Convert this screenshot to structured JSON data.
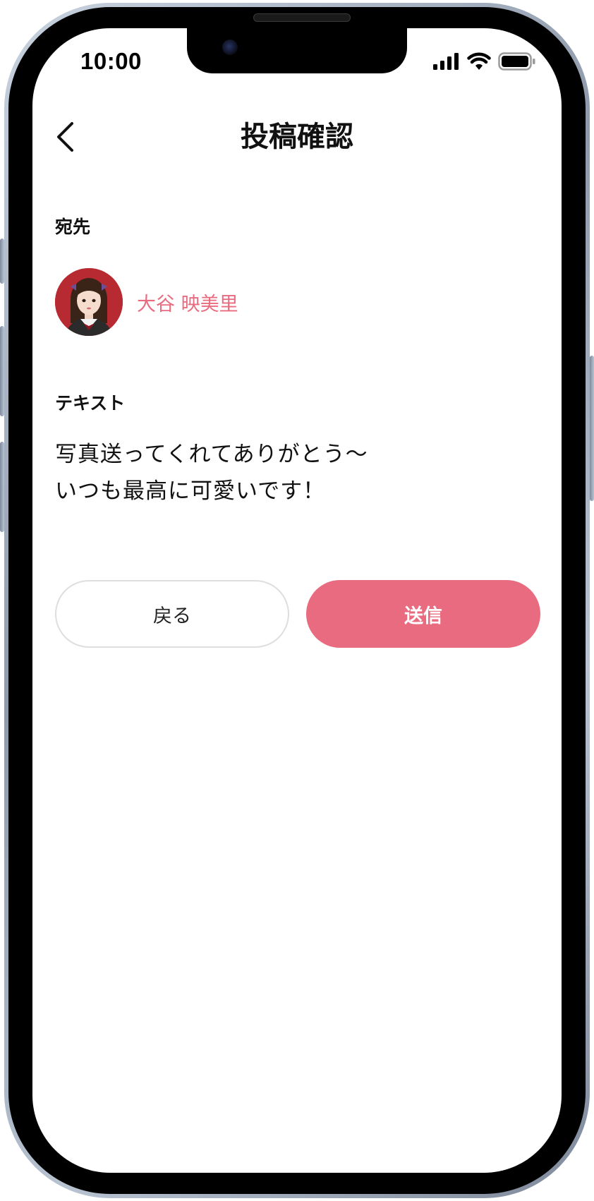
{
  "status_bar": {
    "time": "10:00",
    "icons": [
      "cellular-signal-icon",
      "wifi-icon",
      "battery-icon"
    ]
  },
  "header": {
    "back_icon": "chevron-left-icon",
    "title": "投稿確認"
  },
  "recipient_section": {
    "label": "宛先",
    "name": "大谷 映美里",
    "name_color": "#e96b80"
  },
  "text_section": {
    "label": "テキスト",
    "lines": [
      "写真送ってくれてありがとう～",
      "いつも最高に可愛いです！"
    ]
  },
  "actions": {
    "back_label": "戻る",
    "send_label": "送信",
    "accent_color": "#e96b80"
  }
}
